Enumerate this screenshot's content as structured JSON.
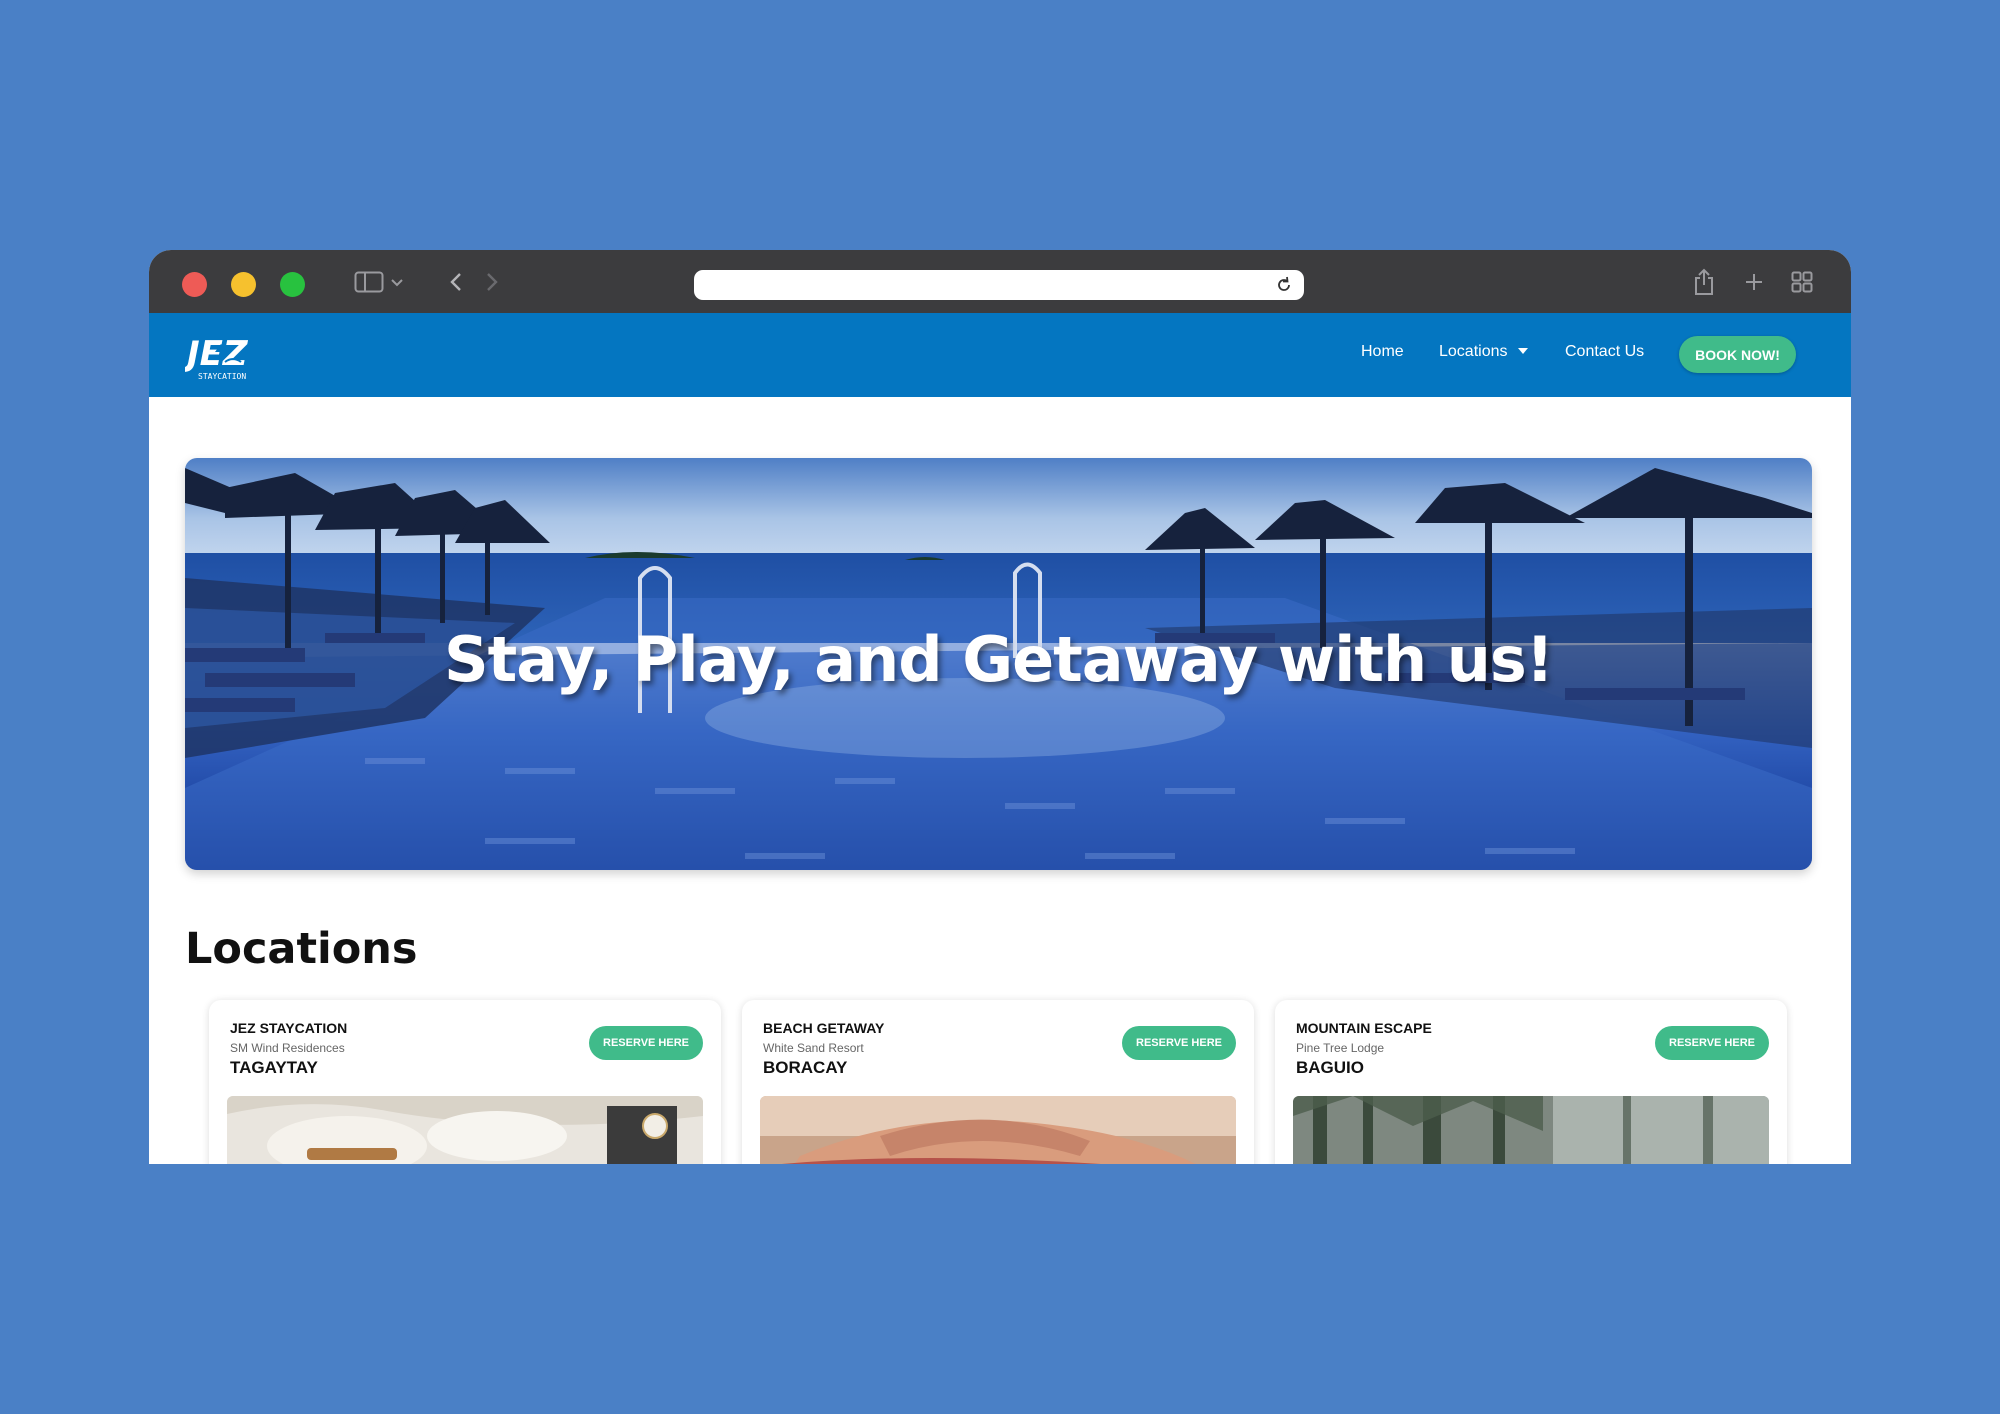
{
  "navbar": {
    "logo_text": "JEZ",
    "logo_subtext": "STAYCATION",
    "links": [
      "Home",
      "Locations",
      "Contact Us"
    ],
    "cta": "BOOK NOW!"
  },
  "hero": {
    "title": "Stay, Play, and Getaway with us!"
  },
  "locations": {
    "title": "Locations",
    "cards": [
      {
        "name": "JEZ STAYCATION",
        "sub": "SM Wind Residences",
        "city": "TAGAYTAY",
        "button": "RESERVE HERE"
      },
      {
        "name": "BEACH GETAWAY",
        "sub": "White Sand Resort",
        "city": "BORACAY",
        "button": "RESERVE HERE"
      },
      {
        "name": "MOUNTAIN ESCAPE",
        "sub": "Pine Tree Lodge",
        "city": "BAGUIO",
        "button": "RESERVE HERE"
      }
    ]
  },
  "colors": {
    "background": "#4a80c6",
    "navbar": "#0476c1",
    "accent_green": "#40bb8a",
    "titlebar": "#3c3c3e"
  }
}
